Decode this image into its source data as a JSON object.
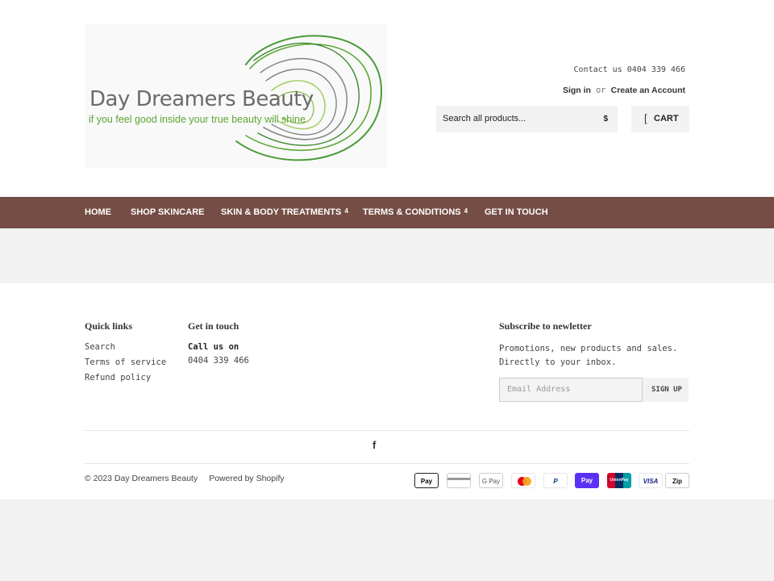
{
  "header": {
    "logo_title": "Day Dreamers Beauty",
    "logo_tagline": "if you feel good inside your true beauty will shine",
    "contact": "Contact us 0404 339 466",
    "sign_in": "Sign in",
    "or": "or",
    "create_account": "Create an Account",
    "search_placeholder": "Search all products...",
    "search_button": "$",
    "cart_icon": "[",
    "cart_label": "CART"
  },
  "nav": {
    "items": [
      {
        "label": "HOME",
        "dropdown": ""
      },
      {
        "label": "SHOP SKINCARE",
        "dropdown": ""
      },
      {
        "label": "SKIN & BODY TREATMENTS",
        "dropdown": "4"
      },
      {
        "label": "TERMS & CONDITIONS",
        "dropdown": "4"
      },
      {
        "label": "GET IN TOUCH",
        "dropdown": ""
      }
    ]
  },
  "footer": {
    "quick_links_title": "Quick links",
    "quick_links": [
      "Search",
      "Terms of service",
      "Refund policy"
    ],
    "get_in_touch_title": "Get in touch",
    "call_us": "Call us on",
    "phone": "0404 339 466",
    "newsletter_title": "Subscribe to newletter",
    "newsletter_text_1": "Promotions, new products and sales.",
    "newsletter_text_2": "Directly to your inbox.",
    "email_placeholder": "Email Address",
    "signup_label": "SIGN UP",
    "social_icon": "f",
    "copyright": "© 2023 Day Dreamers Beauty",
    "powered_by": "Powered by Shopify"
  },
  "payments": [
    {
      "name": "apple-pay",
      "label": "Pay"
    },
    {
      "name": "generic-card",
      "label": ""
    },
    {
      "name": "google-pay",
      "label": "G Pay"
    },
    {
      "name": "mastercard",
      "label": ""
    },
    {
      "name": "paypal",
      "label": "P"
    },
    {
      "name": "shop-pay",
      "label": "Pay"
    },
    {
      "name": "union-pay",
      "label": "UnionPay"
    },
    {
      "name": "visa",
      "label": "VISA"
    },
    {
      "name": "zip",
      "label": "Zip"
    }
  ],
  "colors": {
    "nav_bg": "#754d44",
    "logo_green": "#5da633",
    "shop_pay": "#5a31f4"
  }
}
